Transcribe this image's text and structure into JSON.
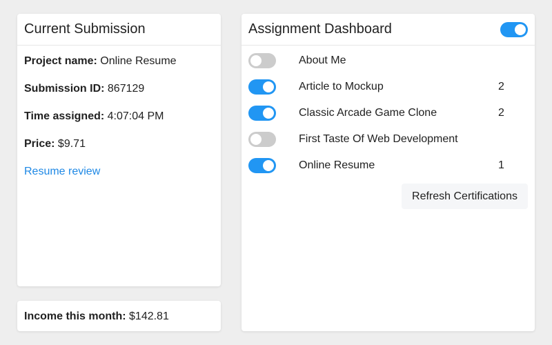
{
  "current_submission": {
    "title": "Current Submission",
    "fields": [
      {
        "label": "Project name:",
        "value": "Online Resume"
      },
      {
        "label": "Submission ID:",
        "value": "867129"
      },
      {
        "label": "Time assigned:",
        "value": "4:07:04 PM"
      },
      {
        "label": "Price:",
        "value": "$9.71"
      }
    ],
    "link_label": "Resume review"
  },
  "income": {
    "label": "Income this month:",
    "value": "$142.81"
  },
  "dashboard": {
    "title": "Assignment Dashboard",
    "master_toggle_on": true,
    "projects": [
      {
        "name": "About Me",
        "enabled": false,
        "count": ""
      },
      {
        "name": "Article to Mockup",
        "enabled": true,
        "count": "2"
      },
      {
        "name": "Classic Arcade Game Clone",
        "enabled": true,
        "count": "2"
      },
      {
        "name": "First Taste Of Web Development",
        "enabled": false,
        "count": ""
      },
      {
        "name": "Online Resume",
        "enabled": true,
        "count": "1"
      }
    ],
    "refresh_label": "Refresh Certifications"
  },
  "colors": {
    "accent": "#2196f3",
    "link": "#1e88e5",
    "toggle_off": "#cccccc"
  }
}
